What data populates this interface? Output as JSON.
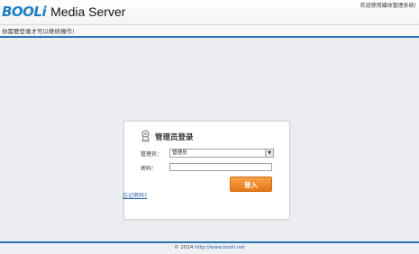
{
  "header": {
    "brand": "BOOLi",
    "product": "Media Server",
    "welcome": "欢迎使用媒体管理系统!"
  },
  "notice": "你需要登录才可以继续操作!",
  "login": {
    "title": "管理员登录",
    "user_label": "管理员：",
    "user_value": "管理员",
    "pass_label": "密码：",
    "pass_value": "",
    "button": "登入"
  },
  "forgot": "忘记密码?",
  "footer": {
    "copyright": "© 2014",
    "url": "http://www.booli.net"
  },
  "colors": {
    "accent": "#2b74b8",
    "button": "#f08a2c",
    "brand": "#1f7fc4"
  }
}
